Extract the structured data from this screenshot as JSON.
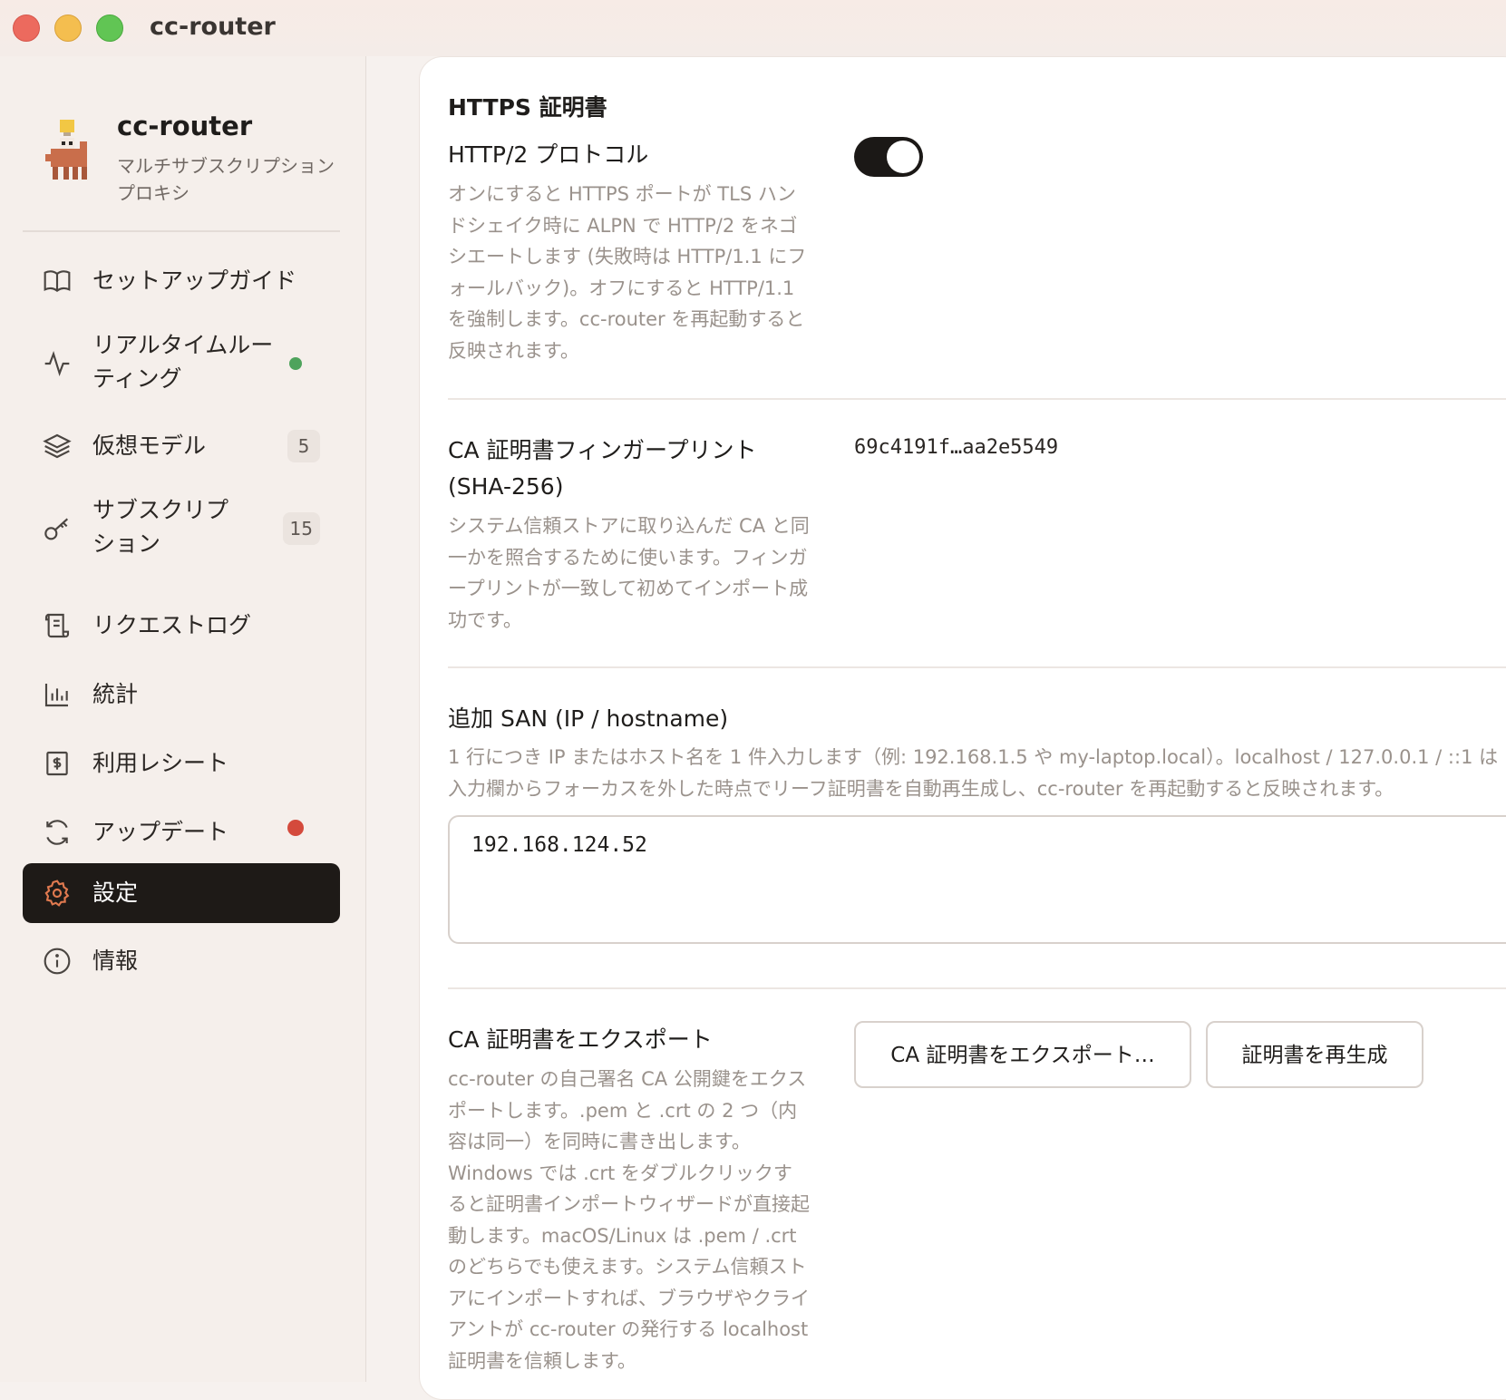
{
  "window": {
    "title": "cc-router"
  },
  "sidebar": {
    "brand": {
      "name": "cc-router",
      "subtitle": "マルチサブスクリプションプロキシ"
    },
    "items": [
      {
        "label": "セットアップガイド",
        "icon": "book-icon"
      },
      {
        "label": "リアルタイムルーティング",
        "icon": "activity-icon",
        "status": "green-dot"
      },
      {
        "label": "仮想モデル",
        "icon": "layers-icon",
        "badge": "5"
      },
      {
        "label": "サブスクリプション",
        "icon": "key-icon",
        "badge": "15"
      },
      {
        "label": "リクエストログ",
        "icon": "scroll-icon"
      },
      {
        "label": "統計",
        "icon": "bar-chart-icon"
      },
      {
        "label": "利用レシート",
        "icon": "receipt-icon"
      },
      {
        "label": "アップデート",
        "icon": "refresh-icon",
        "status": "red-dot"
      },
      {
        "label": "設定",
        "icon": "gear-icon",
        "active": true
      },
      {
        "label": "情報",
        "icon": "info-icon"
      }
    ]
  },
  "main": {
    "section_title": "HTTPS 証明書",
    "http2": {
      "title": "HTTP/2 プロトコル",
      "description": "オンにすると HTTPS ポートが TLS ハンドシェイク時に ALPN で HTTP/2 をネゴシエートします (失敗時は HTTP/1.1 にフォールバック)。オフにすると HTTP/1.1 を強制します。cc-router を再起動すると反映されます。",
      "enabled": true
    },
    "fingerprint": {
      "title_line1": "CA 証明書フィンガープリント",
      "title_line2": "(SHA-256)",
      "value": "69c4191f…aa2e5549",
      "description": "システム信頼ストアに取り込んだ CA と同一かを照合するために使います。フィンガープリントが一致して初めてインポート成功です。"
    },
    "san": {
      "title": "追加 SAN (IP / hostname)",
      "description_line1": "1 行につき IP またはホスト名を 1 件入力します（例: 192.168.1.5 や my-laptop.local）。localhost / 127.0.0.1 / ::1 は",
      "description_line2": "入力欄からフォーカスを外した時点でリーフ証明書を自動再生成し、cc-router を再起動すると反映されます。",
      "value": "192.168.124.52"
    },
    "export": {
      "title": "CA 証明書をエクスポート",
      "description": "cc-router の自己署名 CA 公開鍵をエクスポートします。.pem と .crt の 2 つ（内容は同一）を同時に書き出します。Windows では .crt をダブルクリックすると証明書インポートウィザードが直接起動します。macOS/Linux は .pem / .crt のどちらでも使えます。システム信頼ストアにインポートすれば、ブラウザやクライアントが cc-router の発行する localhost 証明書を信頼します。",
      "export_button": "CA 証明書をエクスポート…",
      "regenerate_button": "証明書を再生成"
    }
  }
}
